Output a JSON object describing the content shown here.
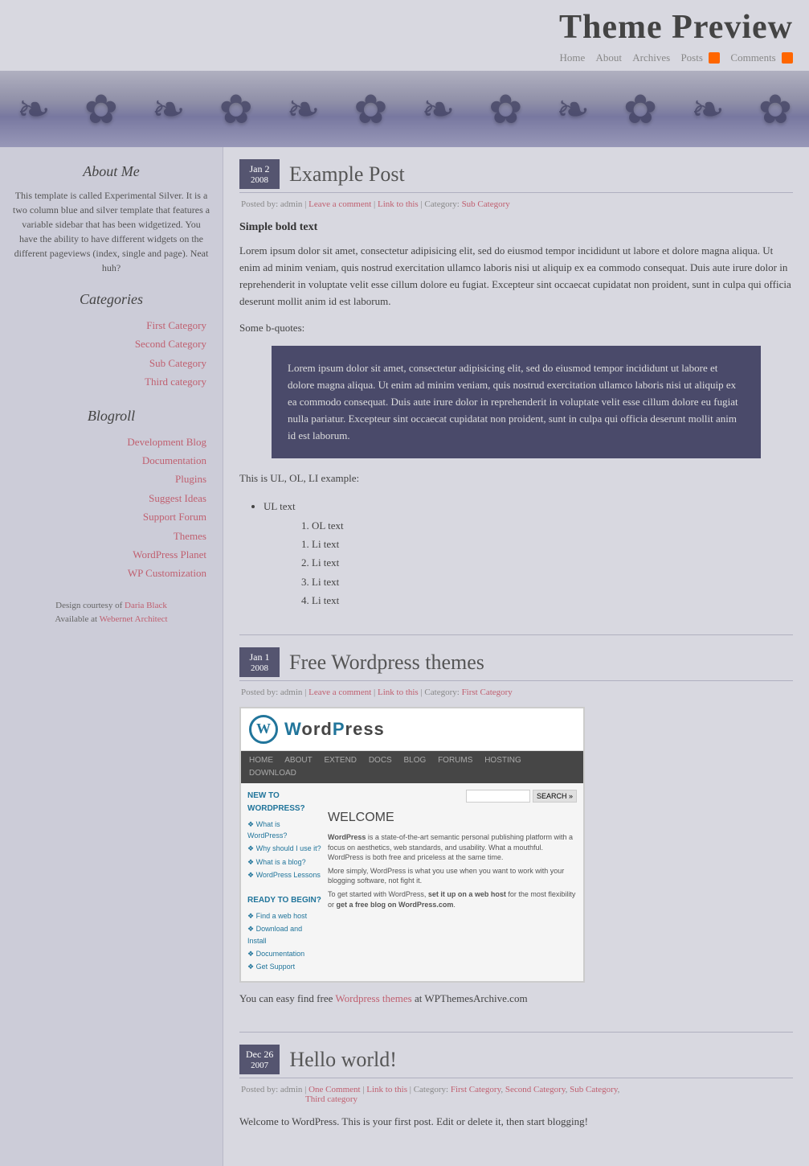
{
  "header": {
    "title": "Theme Preview",
    "nav": {
      "home": "Home",
      "about": "About",
      "archives": "Archives",
      "posts": "Posts",
      "comments": "Comments"
    }
  },
  "sidebar": {
    "about_heading": "About Me",
    "about_text": "This template is called Experimental Silver. It is a two column blue and silver template that features a variable sidebar that has been widgetized. You have the ability to have different widgets on the different pageviews (index, single and page). Neat huh?",
    "categories_heading": "Categories",
    "categories": [
      {
        "label": "First Category",
        "href": "#"
      },
      {
        "label": "Second Category",
        "href": "#"
      },
      {
        "label": "Sub Category",
        "href": "#"
      },
      {
        "label": "Third category",
        "href": "#"
      }
    ],
    "blogroll_heading": "Blogroll",
    "blogroll": [
      {
        "label": "Development Blog",
        "href": "#"
      },
      {
        "label": "Documentation",
        "href": "#"
      },
      {
        "label": "Plugins",
        "href": "#"
      },
      {
        "label": "Suggest Ideas",
        "href": "#"
      },
      {
        "label": "Support Forum",
        "href": "#"
      },
      {
        "label": "Themes",
        "href": "#"
      },
      {
        "label": "WordPress Planet",
        "href": "#"
      },
      {
        "label": "WP Customization",
        "href": "#"
      }
    ],
    "footer_line1": "Design courtesy of",
    "footer_daria": "Daria Black",
    "footer_line2": "Available at",
    "footer_webernet": "Webernet Architect"
  },
  "posts": [
    {
      "id": "example-post",
      "date_month": "Jan 2",
      "date_year": "2008",
      "title": "Example Post",
      "meta": "Posted by: admin | Leave a comment | Link to this | Category: Sub Category",
      "meta_leave_comment": "Leave a comment",
      "meta_link": "Link to this",
      "meta_category": "Sub Category",
      "bold_heading": "Simple bold text",
      "paragraph": "Lorem ipsum dolor sit amet, consectetur adipisicing elit, sed do eiusmod tempor incididunt ut labore et dolore magna aliqua. Ut enim ad minim veniam, quis nostrud exercitation ullamco laboris nisi ut aliquip ex ea commodo consequat. Duis aute irure dolor in reprehenderit in voluptate velit esse cillum dolore eu fugiat. Excepteur sint occaecat cupidatat non proident, sunt in culpa qui officia deserunt mollit anim id est laborum.",
      "bquotes_label": "Some b-quotes:",
      "blockquote": "Lorem ipsum dolor sit amet, consectetur adipisicing elit, sed do eiusmod tempor incididunt ut labore et dolore magna aliqua. Ut enim ad minim veniam, quis nostrud exercitation ullamco laboris nisi ut aliquip ex ea commodo consequat. Duis aute irure dolor in reprehenderit in voluptate velit esse cillum dolore eu fugiat nulla pariatur. Excepteur sint occaecat cupidatat non proident, sunt in culpa qui officia deserunt mollit anim id est laborum.",
      "ul_label": "This is UL, OL, LI example:",
      "ul_item": "UL text",
      "ol_item": "OL text",
      "li_items": [
        "Li text",
        "Li text",
        "Li text",
        "Li text"
      ]
    },
    {
      "id": "free-wp-themes",
      "date_month": "Jan 1",
      "date_year": "2008",
      "title": "Free Wordpress themes",
      "meta": "Posted by: admin | Leave a comment | Link to this | Category: First Category",
      "meta_leave_comment": "Leave a comment",
      "meta_link": "Link to this",
      "meta_category": "First Category",
      "body_text_before": "You can easy find free",
      "wp_themes_link_text": "Wordpress themes",
      "body_text_after": "at WPThemesArchive.com"
    },
    {
      "id": "hello-world",
      "date_month": "Dec 26",
      "date_year": "2007",
      "title": "Hello world!",
      "meta_posted": "Posted by: admin",
      "meta_comment": "One Comment",
      "meta_link": "Link to this",
      "meta_cat_label": "Category:",
      "meta_categories": "First Category, Second Category, Sub Category,",
      "meta_cat3": "Third category",
      "body_text": "Welcome to WordPress. This is your first post. Edit or delete it, then start blogging!"
    }
  ],
  "wordpress_logo": "WordPress",
  "wordpress_welcome": "WELCOME"
}
